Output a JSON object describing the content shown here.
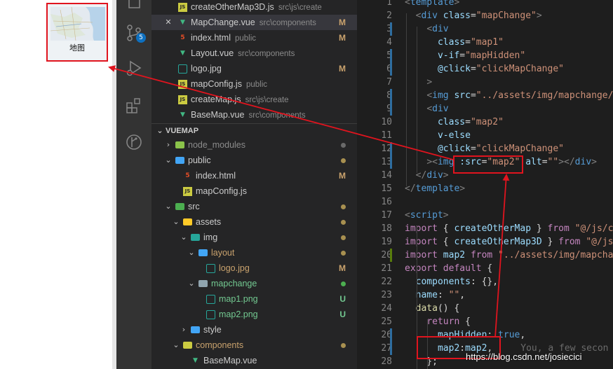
{
  "thumbnail": {
    "label": "地图"
  },
  "activity_bar": {
    "scm_badge": "5",
    "icons": [
      "files-icon",
      "source-control-icon",
      "run-debug-icon",
      "extensions-icon",
      "git-graph-icon"
    ]
  },
  "open_editors": [
    {
      "name": "createOtherMap3D.js",
      "path": "src\\js\\create",
      "icon": "JS",
      "icon_color": "#cbcb41",
      "status": "",
      "selected": false,
      "close": false
    },
    {
      "name": "MapChange.vue",
      "path": "src\\components",
      "icon": "vue",
      "icon_color": "#41b883",
      "status": "M",
      "selected": true,
      "close": true,
      "close_glyph": "✕"
    },
    {
      "name": "index.html",
      "path": "public",
      "icon": "5",
      "icon_color": "#e44d26",
      "status": "M",
      "selected": false,
      "close": false
    },
    {
      "name": "Layout.vue",
      "path": "src\\components",
      "icon": "vue",
      "icon_color": "#41b883",
      "status": "",
      "selected": false,
      "close": false
    },
    {
      "name": "logo.jpg",
      "path": "",
      "icon": "img",
      "icon_color": "#26a69a",
      "status": "M",
      "selected": false,
      "close": false
    },
    {
      "name": "mapConfig.js",
      "path": "public",
      "icon": "JS",
      "icon_color": "#cbcb41",
      "status": "",
      "selected": false,
      "close": false
    },
    {
      "name": "createMap.js",
      "path": "src\\js\\create",
      "icon": "JS",
      "icon_color": "#cbcb41",
      "status": "",
      "selected": false,
      "close": false
    },
    {
      "name": "BaseMap.vue",
      "path": "src\\components",
      "icon": "vue",
      "icon_color": "#41b883",
      "status": "",
      "selected": false,
      "close": false
    }
  ],
  "explorer": {
    "title": "VUEMAP",
    "items": [
      {
        "name": "node_modules",
        "kind": "folder",
        "depth": 1,
        "open": false,
        "color": "#8b8b8b",
        "icon_color": "#8bc34a",
        "status": "",
        "dot": "#6a6a6a"
      },
      {
        "name": "public",
        "kind": "folder",
        "depth": 1,
        "open": true,
        "color": "#cccccc",
        "icon_color": "#42a5f5",
        "status": "",
        "dot": "#a89050"
      },
      {
        "name": "index.html",
        "kind": "file",
        "depth": 2,
        "color": "#cccccc",
        "icon": "5",
        "icon_color": "#e44d26",
        "status": "M",
        "status_color": "#c9a26d"
      },
      {
        "name": "mapConfig.js",
        "kind": "file",
        "depth": 2,
        "color": "#cccccc",
        "icon": "JS",
        "icon_color": "#cbcb41",
        "status": "",
        "dot": ""
      },
      {
        "name": "src",
        "kind": "folder",
        "depth": 1,
        "open": true,
        "color": "#cccccc",
        "icon_color": "#4caf50",
        "status": "",
        "dot": "#a89050"
      },
      {
        "name": "assets",
        "kind": "folder",
        "depth": 2,
        "open": true,
        "color": "#cccccc",
        "icon_color": "#ffca28",
        "status": "",
        "dot": "#a89050"
      },
      {
        "name": "img",
        "kind": "folder",
        "depth": 3,
        "open": true,
        "color": "#cccccc",
        "icon_color": "#26a69a",
        "status": "",
        "dot": "#a89050"
      },
      {
        "name": "layout",
        "kind": "folder",
        "depth": 4,
        "open": true,
        "color": "#c9a26d",
        "icon_color": "#42a5f5",
        "status": "",
        "dot": "#a89050"
      },
      {
        "name": "logo.jpg",
        "kind": "file",
        "depth": 5,
        "color": "#c9a26d",
        "icon": "img",
        "icon_color": "#26a69a",
        "status": "M",
        "status_color": "#c9a26d"
      },
      {
        "name": "mapchange",
        "kind": "folder",
        "depth": 4,
        "open": true,
        "color": "#73c991",
        "icon_color": "#90a4ae",
        "status": "",
        "dot": "#4caf50"
      },
      {
        "name": "map1.png",
        "kind": "file",
        "depth": 5,
        "color": "#73c991",
        "icon": "img",
        "icon_color": "#26a69a",
        "status": "U",
        "status_color": "#73c991"
      },
      {
        "name": "map2.png",
        "kind": "file",
        "depth": 5,
        "color": "#73c991",
        "icon": "img",
        "icon_color": "#26a69a",
        "status": "U",
        "status_color": "#73c991"
      },
      {
        "name": "style",
        "kind": "folder",
        "depth": 3,
        "open": false,
        "color": "#cccccc",
        "icon_color": "#42a5f5",
        "status": "",
        "dot": ""
      },
      {
        "name": "components",
        "kind": "folder",
        "depth": 2,
        "open": true,
        "color": "#c9a26d",
        "icon_color": "#cbcb41",
        "status": "",
        "dot": "#a89050"
      },
      {
        "name": "BaseMap.vue",
        "kind": "file",
        "depth": 3,
        "color": "#cccccc",
        "icon": "vue",
        "icon_color": "#41b883",
        "status": "",
        "dot": ""
      }
    ]
  },
  "editor": {
    "line_numbers": [
      "1",
      "2",
      "3",
      "4",
      "5",
      "6",
      "7",
      "8",
      "9",
      "10",
      "11",
      "12",
      "13",
      "14",
      "15",
      "16",
      "17",
      "18",
      "19",
      "20",
      "21",
      "22",
      "23",
      "24",
      "25",
      "26",
      "27",
      "28"
    ],
    "lines": [
      [
        [
          "t-pun",
          "<"
        ],
        [
          "t-tag",
          "template"
        ],
        [
          "t-pun",
          ">"
        ]
      ],
      [
        [
          "t-txt",
          "  "
        ],
        [
          "t-pun",
          "<"
        ],
        [
          "t-tag",
          "div"
        ],
        [
          "t-txt",
          " "
        ],
        [
          "t-attr",
          "class"
        ],
        [
          "t-txt",
          "="
        ],
        [
          "t-str",
          "\"mapChange\""
        ],
        [
          "t-pun",
          ">"
        ]
      ],
      [
        [
          "t-txt",
          "    "
        ],
        [
          "t-pun",
          "<"
        ],
        [
          "t-tag",
          "div"
        ]
      ],
      [
        [
          "t-txt",
          "      "
        ],
        [
          "t-attr",
          "class"
        ],
        [
          "t-txt",
          "="
        ],
        [
          "t-str",
          "\"map1\""
        ]
      ],
      [
        [
          "t-txt",
          "      "
        ],
        [
          "t-attr",
          "v-if"
        ],
        [
          "t-txt",
          "="
        ],
        [
          "t-str",
          "\"mapHidden\""
        ]
      ],
      [
        [
          "t-txt",
          "      "
        ],
        [
          "t-attr",
          "@click"
        ],
        [
          "t-txt",
          "="
        ],
        [
          "t-str",
          "\"clickMapChange\""
        ]
      ],
      [
        [
          "t-txt",
          "    "
        ],
        [
          "t-pun",
          ">"
        ]
      ],
      [
        [
          "t-txt",
          "    "
        ],
        [
          "t-pun",
          "<"
        ],
        [
          "t-tag",
          "img"
        ],
        [
          "t-txt",
          " "
        ],
        [
          "t-attr",
          "src"
        ],
        [
          "t-txt",
          "="
        ],
        [
          "t-str",
          "\"../assets/img/mapchange/m"
        ]
      ],
      [
        [
          "t-txt",
          "    "
        ],
        [
          "t-pun",
          "<"
        ],
        [
          "t-tag",
          "div"
        ]
      ],
      [
        [
          "t-txt",
          "      "
        ],
        [
          "t-attr",
          "class"
        ],
        [
          "t-txt",
          "="
        ],
        [
          "t-str",
          "\"map2\""
        ]
      ],
      [
        [
          "t-txt",
          "      "
        ],
        [
          "t-attr",
          "v-else"
        ]
      ],
      [
        [
          "t-txt",
          "      "
        ],
        [
          "t-attr",
          "@click"
        ],
        [
          "t-txt",
          "="
        ],
        [
          "t-str",
          "\"clickMapChange\""
        ]
      ],
      [
        [
          "t-txt",
          "    "
        ],
        [
          "t-pun",
          "><"
        ],
        [
          "t-tag",
          "img"
        ],
        [
          "t-txt",
          " "
        ],
        [
          "t-attr",
          ":src"
        ],
        [
          "t-txt",
          "="
        ],
        [
          "t-str",
          "\"map2\""
        ],
        [
          "t-txt",
          " "
        ],
        [
          "t-attr",
          "alt"
        ],
        [
          "t-txt",
          "="
        ],
        [
          "t-str",
          "\"\""
        ],
        [
          "t-pun",
          "></"
        ],
        [
          "t-tag",
          "div"
        ],
        [
          "t-pun",
          ">"
        ]
      ],
      [
        [
          "t-txt",
          "  "
        ],
        [
          "t-pun",
          "</"
        ],
        [
          "t-tag",
          "div"
        ],
        [
          "t-pun",
          ">"
        ]
      ],
      [
        [
          "t-pun",
          "</"
        ],
        [
          "t-tag",
          "template"
        ],
        [
          "t-pun",
          ">"
        ]
      ],
      [
        [
          "t-txt",
          ""
        ]
      ],
      [
        [
          "t-pun",
          "<"
        ],
        [
          "t-tag",
          "script"
        ],
        [
          "t-pun",
          ">"
        ]
      ],
      [
        [
          "t-kw",
          "import"
        ],
        [
          "t-txt",
          " { "
        ],
        [
          "t-var",
          "createOtherMap"
        ],
        [
          "t-txt",
          " } "
        ],
        [
          "t-kw",
          "from"
        ],
        [
          "t-txt",
          " "
        ],
        [
          "t-str",
          "\"@/js/cr"
        ]
      ],
      [
        [
          "t-kw",
          "import"
        ],
        [
          "t-txt",
          " { "
        ],
        [
          "t-var",
          "createOtherMap3D"
        ],
        [
          "t-txt",
          " } "
        ],
        [
          "t-kw",
          "from"
        ],
        [
          "t-txt",
          " "
        ],
        [
          "t-str",
          "\"@/js/"
        ]
      ],
      [
        [
          "t-kw",
          "import"
        ],
        [
          "t-txt",
          " "
        ],
        [
          "t-var",
          "map2"
        ],
        [
          "t-txt",
          " "
        ],
        [
          "t-kw",
          "from"
        ],
        [
          "t-txt",
          " "
        ],
        [
          "t-str",
          "\"../assets/img/mapchan"
        ]
      ],
      [
        [
          "t-kw",
          "export"
        ],
        [
          "t-txt",
          " "
        ],
        [
          "t-kw",
          "default"
        ],
        [
          "t-txt",
          " {"
        ]
      ],
      [
        [
          "t-txt",
          "  "
        ],
        [
          "t-var",
          "components"
        ],
        [
          "t-txt",
          ": {},"
        ]
      ],
      [
        [
          "t-txt",
          "  "
        ],
        [
          "t-var",
          "name"
        ],
        [
          "t-txt",
          ": "
        ],
        [
          "t-str",
          "\"\""
        ],
        [
          "t-txt",
          ","
        ]
      ],
      [
        [
          "t-txt",
          "  "
        ],
        [
          "t-fn",
          "data"
        ],
        [
          "t-txt",
          "() {"
        ]
      ],
      [
        [
          "t-txt",
          "    "
        ],
        [
          "t-kw",
          "return"
        ],
        [
          "t-txt",
          " {"
        ]
      ],
      [
        [
          "t-txt",
          "      "
        ],
        [
          "t-var",
          "mapHidden"
        ],
        [
          "t-txt",
          ": "
        ],
        [
          "t-kw2",
          "true"
        ],
        [
          "t-txt",
          ","
        ]
      ],
      [
        [
          "t-txt",
          "      "
        ],
        [
          "t-var",
          "map2"
        ],
        [
          "t-txt",
          ":"
        ],
        [
          "t-var",
          "map2"
        ],
        [
          "t-txt",
          ","
        ]
      ],
      [
        [
          "t-txt",
          "    };"
        ]
      ]
    ],
    "ghost_text": "You, a few secon",
    "modified_lines": [
      3,
      5,
      6,
      8,
      9,
      12,
      13,
      20,
      26,
      27
    ]
  },
  "watermark": "https://blog.csdn.net/josiecici",
  "annotation_color": "#e0141e"
}
